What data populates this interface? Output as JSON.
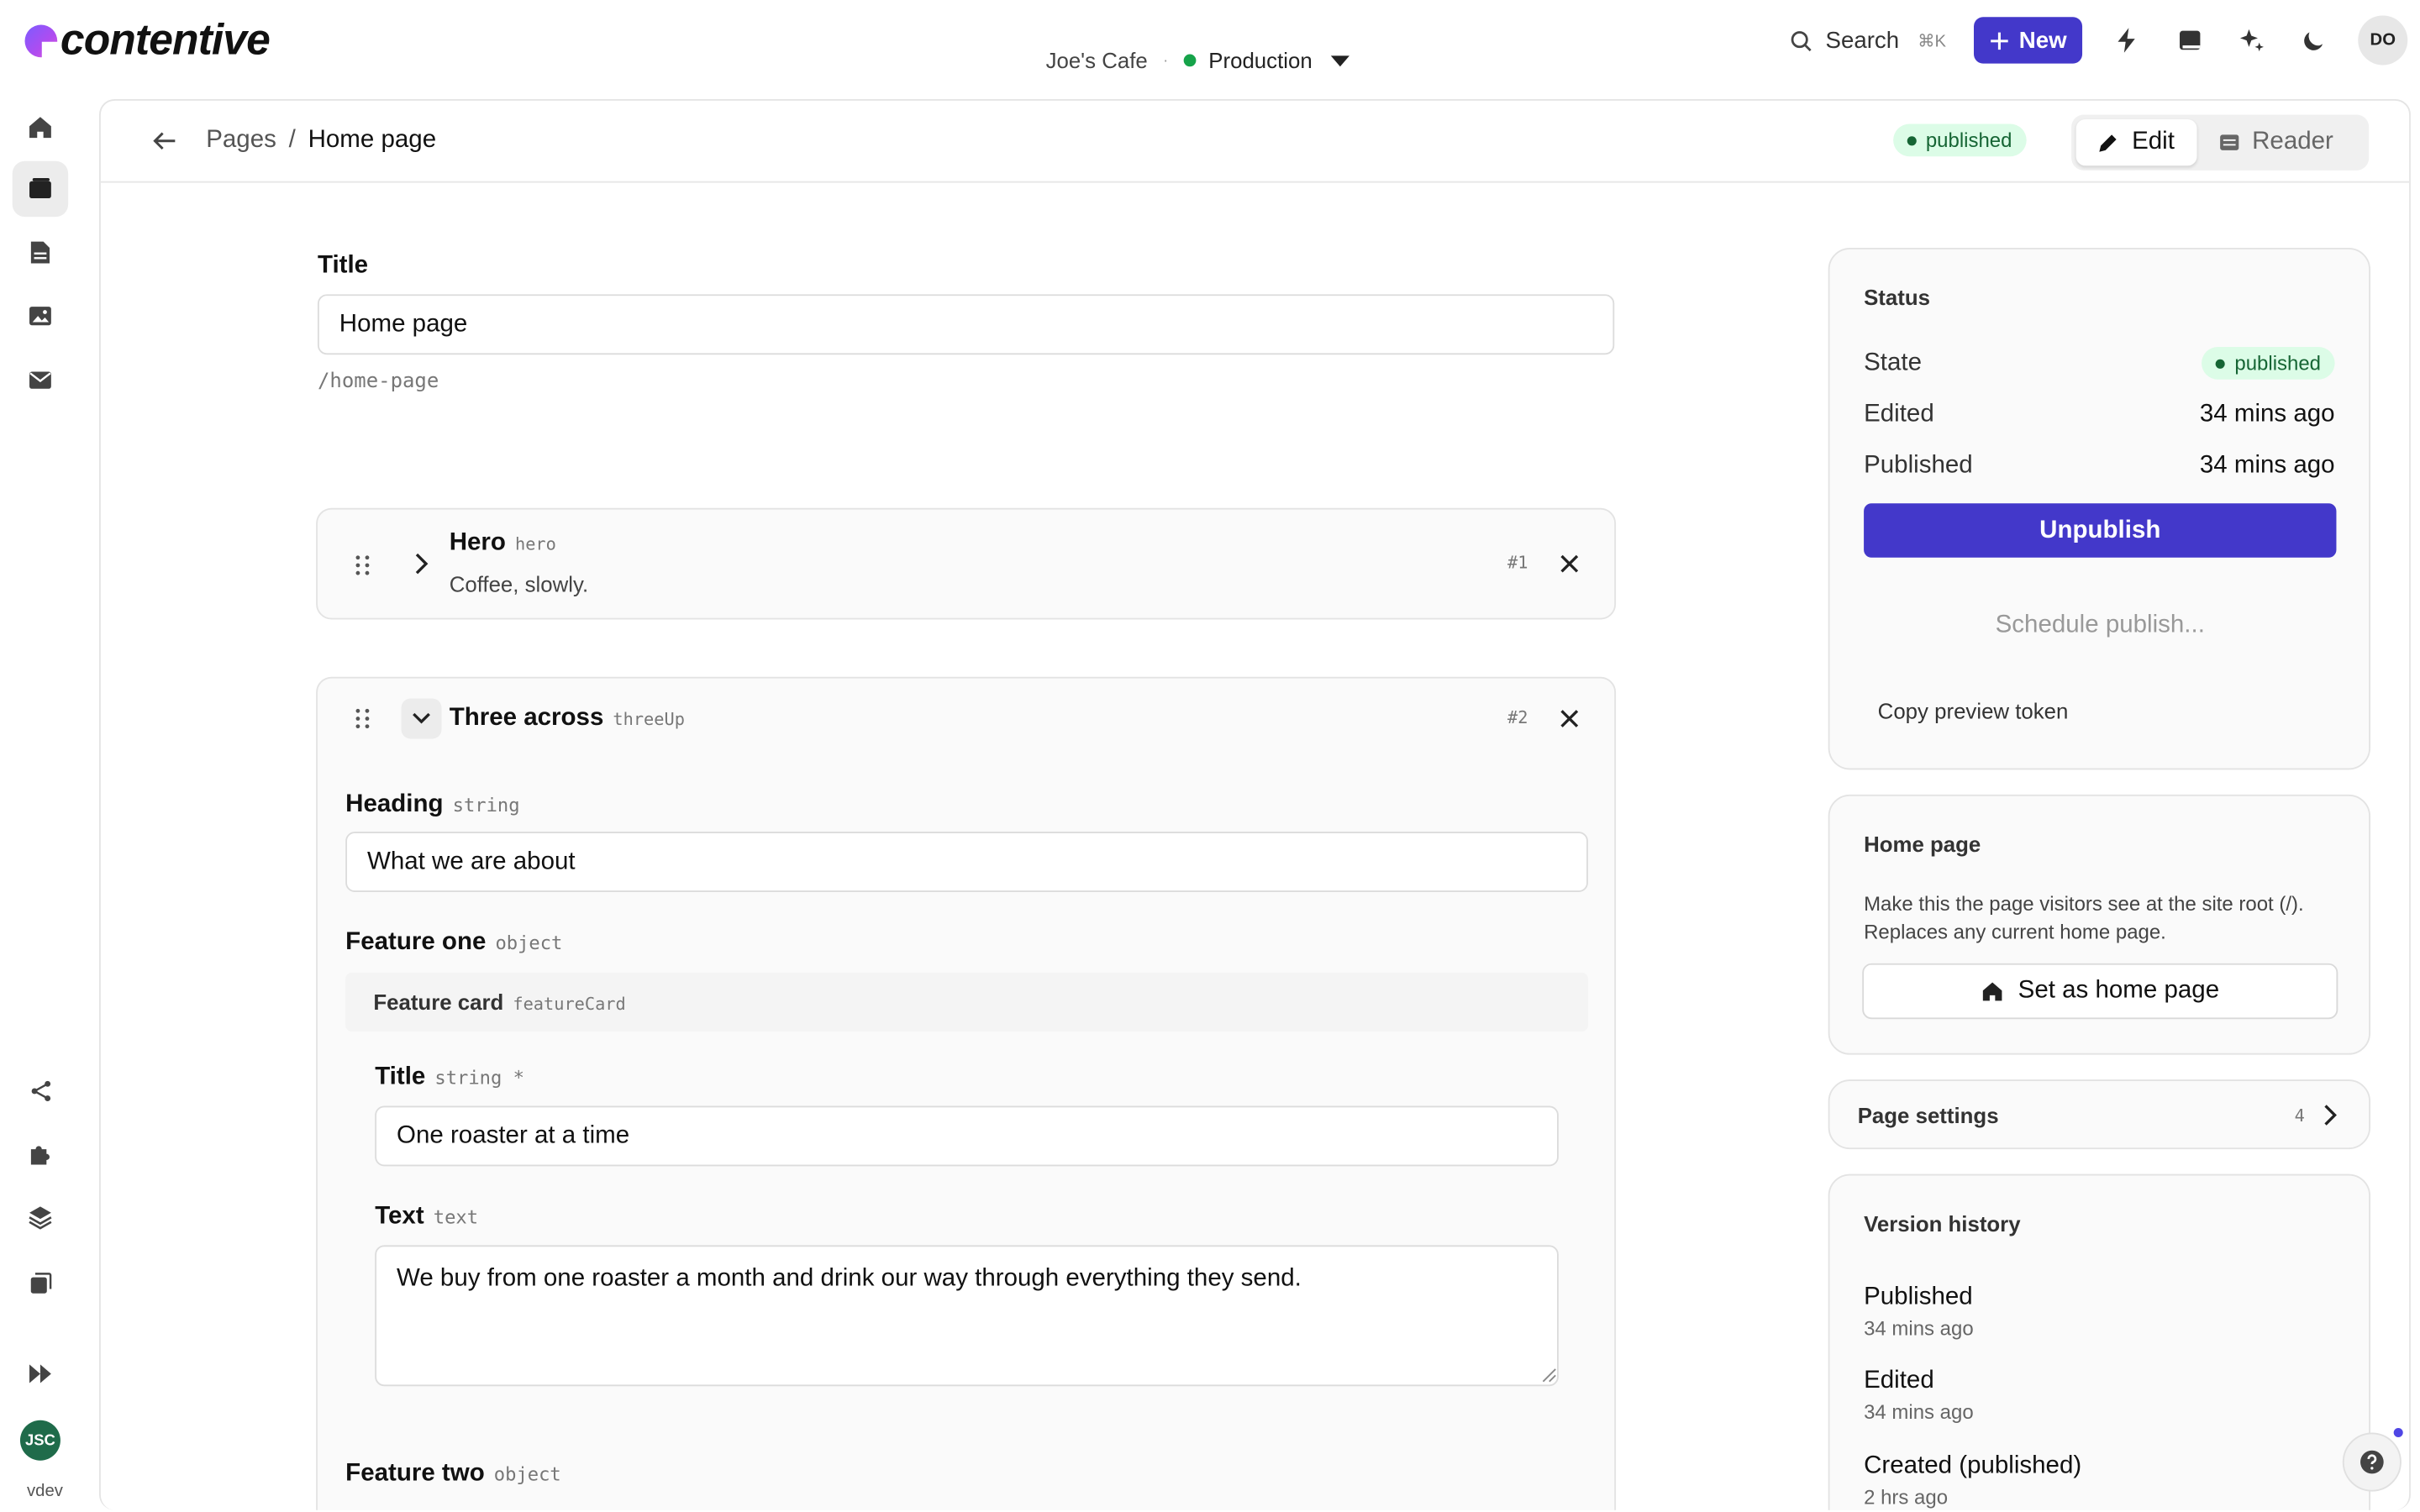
{
  "app": {
    "logo_text": "contentive"
  },
  "env": {
    "site": "Joe's Cafe",
    "separator": "·",
    "environment": "Production"
  },
  "toolbar": {
    "search_label": "Search",
    "search_shortcut": "⌘K",
    "new_label": "New",
    "user_initials": "DO"
  },
  "rail": {
    "user_initials": "JSC",
    "user_label": "vdev"
  },
  "header": {
    "breadcrumb_root": "Pages",
    "breadcrumb_sep": "/",
    "breadcrumb_current": "Home page",
    "status": "published",
    "edit_label": "Edit",
    "reader_label": "Reader"
  },
  "form": {
    "title_label": "Title",
    "title_value": "Home page",
    "slug": "/home-page",
    "blocks": [
      {
        "title": "Hero",
        "type": "hero",
        "summary": "Coffee, slowly.",
        "num": "#1"
      },
      {
        "title": "Three across",
        "type": "threeUp",
        "num": "#2"
      }
    ],
    "heading_label": "Heading",
    "heading_type": "string",
    "heading_value": "What we are about",
    "feature_one_label": "Feature one",
    "feature_one_type": "object",
    "feature_card_label": "Feature card",
    "feature_card_type": "featureCard",
    "fc_title_label": "Title",
    "fc_title_type": "string *",
    "fc_title_value": "One roaster at a time",
    "fc_text_label": "Text",
    "fc_text_type": "text",
    "fc_text_value": "We buy from one roaster a month and drink our way through everything they send.",
    "feature_two_label": "Feature two",
    "feature_two_type": "object"
  },
  "status_card": {
    "title": "Status",
    "state_label": "State",
    "state_value": "published",
    "edited_label": "Edited",
    "edited_value": "34 mins ago",
    "published_label": "Published",
    "published_value": "34 mins ago",
    "unpublish_label": "Unpublish",
    "schedule_label": "Schedule publish...",
    "copy_token_label": "Copy preview token"
  },
  "home_card": {
    "title": "Home page",
    "description": "Make this the page visitors see at the site root (/). Replaces any current home page.",
    "button_label": "Set as home page"
  },
  "settings_card": {
    "title": "Page settings",
    "count": "4"
  },
  "history_card": {
    "title": "Version history",
    "items": [
      {
        "label": "Published",
        "time": "34 mins ago"
      },
      {
        "label": "Edited",
        "time": "34 mins ago"
      },
      {
        "label": "Created (published)",
        "time": "2 hrs ago"
      }
    ]
  },
  "colors": {
    "accent": "#4338ca",
    "published_bg": "#dcfce7",
    "published_fg": "#166534"
  }
}
